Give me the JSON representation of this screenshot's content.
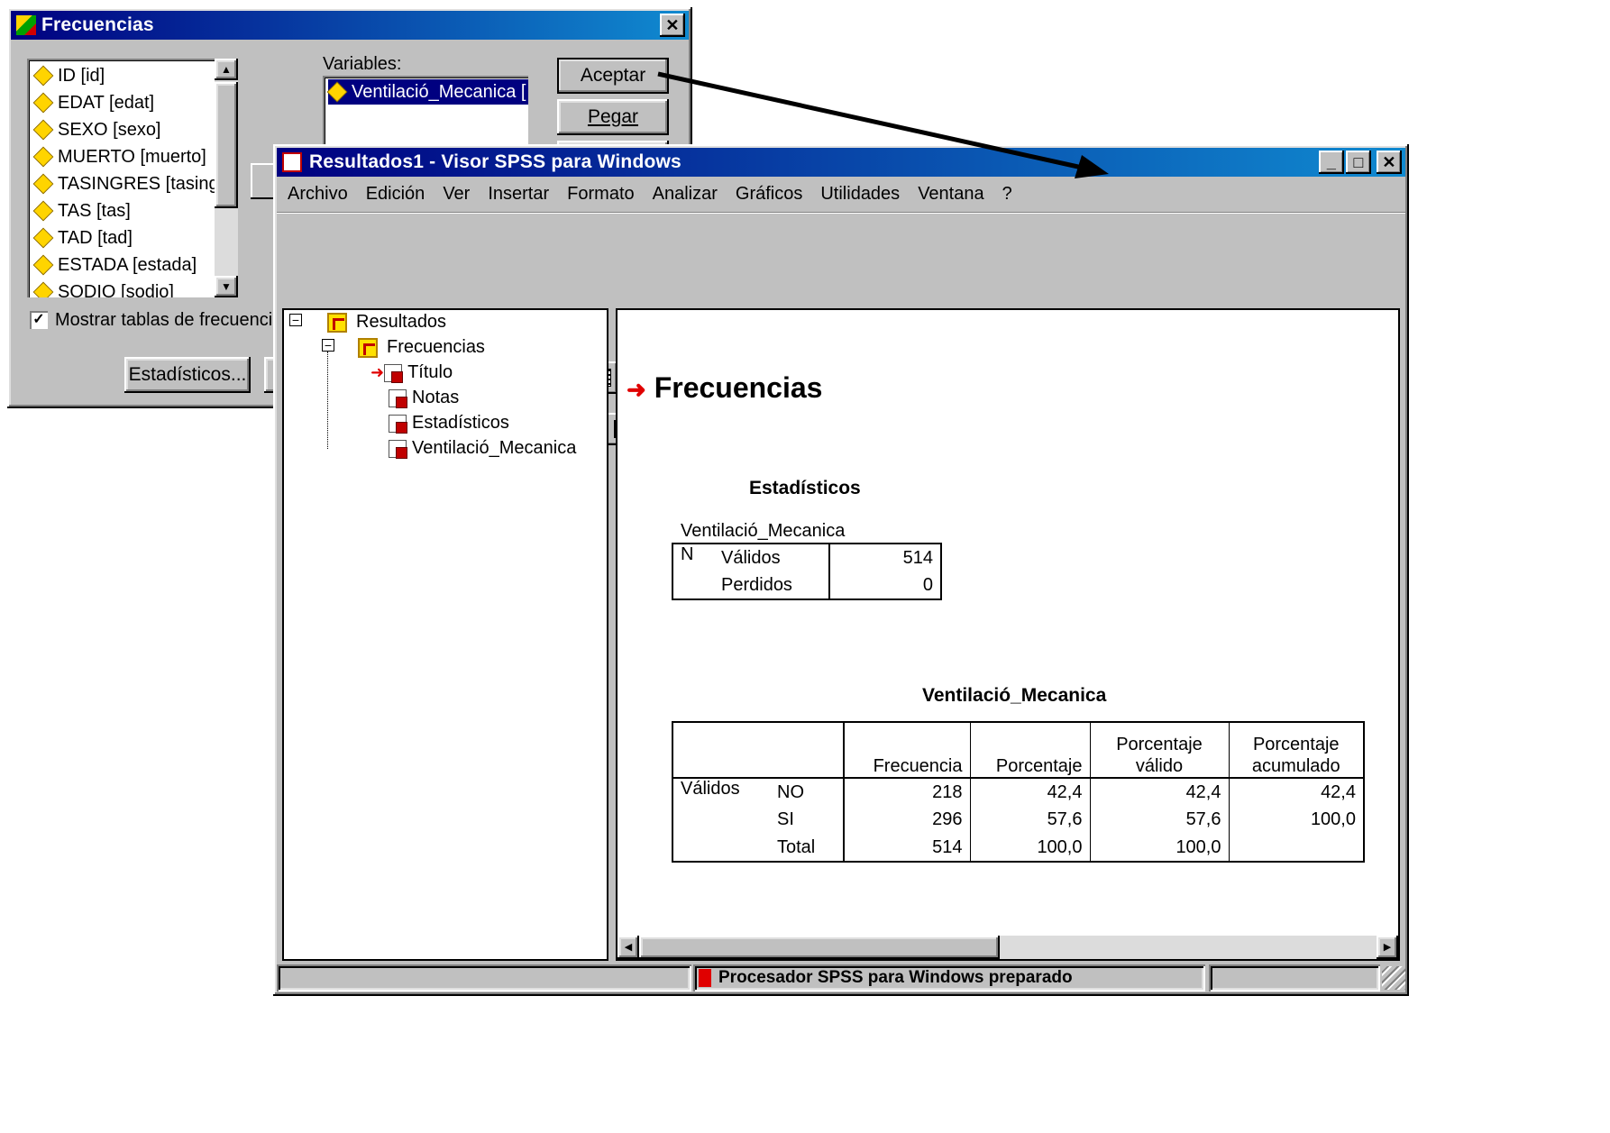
{
  "dialog": {
    "title": "Frecuencias",
    "variables_label": "Variables:",
    "source_vars": [
      "ID [id]",
      "EDAT [edat]",
      "SEXO [sexo]",
      "MUERTO [muerto]",
      "TASINGRES [tasing",
      "TAS [tas]",
      "TAD [tad]",
      "ESTADA [estada]",
      "SODIO [sodio]"
    ],
    "selected_var": "Ventilació_Mecanica [",
    "buttons": {
      "accept": "Aceptar",
      "paste": "Pegar",
      "statistics": "Estadísticos..."
    },
    "checkbox_label": "Mostrar tablas de frecuencias"
  },
  "viewer": {
    "title": "Resultados1 - Visor SPSS para Windows",
    "menu": [
      "Archivo",
      "Edición",
      "Ver",
      "Insertar",
      "Formato",
      "Analizar",
      "Gráficos",
      "Utilidades",
      "Ventana",
      "?"
    ],
    "tree": {
      "root": "Resultados",
      "child": "Frecuencias",
      "leaves": [
        "Título",
        "Notas",
        "Estadísticos",
        "Ventilació_Mecanica"
      ]
    },
    "output": {
      "heading": "Frecuencias",
      "stats": {
        "title": "Estadísticos",
        "var": "Ventilació_Mecanica",
        "n": "N",
        "rows": [
          {
            "label": "Válidos",
            "value": "514"
          },
          {
            "label": "Perdidos",
            "value": "0"
          }
        ]
      },
      "freq": {
        "title": "Ventilació_Mecanica",
        "headers": [
          "Frecuencia",
          "Porcentaje",
          "Porcentaje válido",
          "Porcentaje acumulado"
        ],
        "group": "Válidos",
        "rows": [
          {
            "label": "NO",
            "cells": [
              "218",
              "42,4",
              "42,4",
              "42,4"
            ]
          },
          {
            "label": "SI",
            "cells": [
              "296",
              "57,6",
              "57,6",
              "100,0"
            ]
          },
          {
            "label": "Total",
            "cells": [
              "514",
              "100,0",
              "100,0",
              ""
            ]
          }
        ]
      }
    },
    "status": "Procesador SPSS para Windows preparado"
  }
}
